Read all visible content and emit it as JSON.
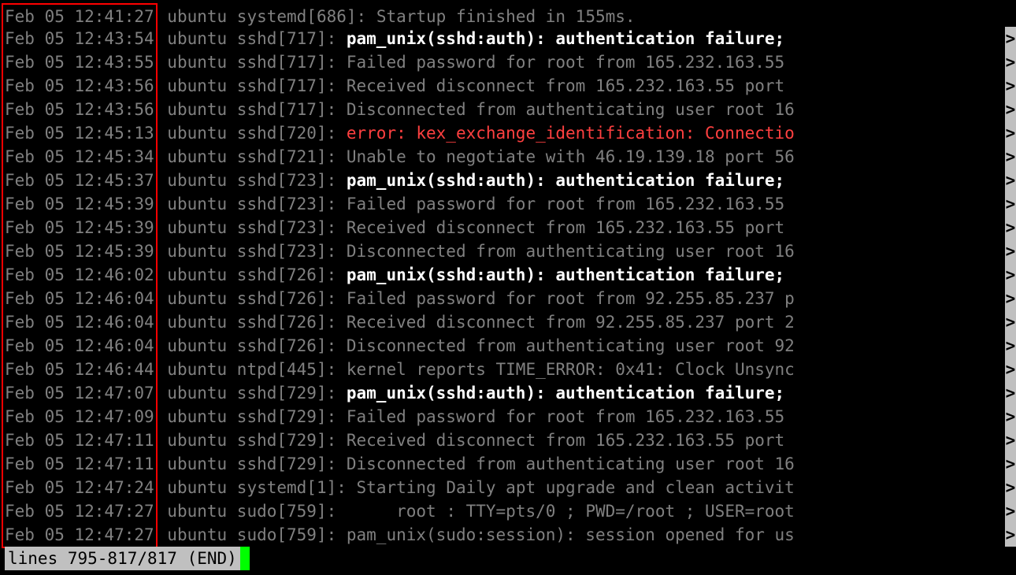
{
  "status_line": "lines 795-817/817 (END)",
  "truncation_mark": ">",
  "log_lines": [
    {
      "timestamp": "Feb 05 12:41:27",
      "prefix": " ubuntu systemd[686]: ",
      "segments": [
        {
          "cls": "dim",
          "t": "Startup finished in 155ms."
        }
      ],
      "truncated": false,
      "box": true,
      "first": true
    },
    {
      "timestamp": "Feb 05 12:43:54",
      "prefix": " ubuntu sshd[717]: ",
      "segments": [
        {
          "cls": "white",
          "t": "pam_unix(sshd:auth): authentication failure;"
        }
      ],
      "truncated": true,
      "box": true
    },
    {
      "timestamp": "Feb 05 12:43:55",
      "prefix": " ubuntu sshd[717]: ",
      "segments": [
        {
          "cls": "dim",
          "t": "Failed password for root from 165.232.163.55"
        }
      ],
      "truncated": true,
      "box": true
    },
    {
      "timestamp": "Feb 05 12:43:56",
      "prefix": " ubuntu sshd[717]: ",
      "segments": [
        {
          "cls": "dim",
          "t": "Received disconnect from 165.232.163.55 port "
        }
      ],
      "truncated": true,
      "box": true
    },
    {
      "timestamp": "Feb 05 12:43:56",
      "prefix": " ubuntu sshd[717]: ",
      "segments": [
        {
          "cls": "dim",
          "t": "Disconnected from authenticating user root 16"
        }
      ],
      "truncated": true,
      "box": true
    },
    {
      "timestamp": "Feb 05 12:45:13",
      "prefix": " ubuntu sshd[720]: ",
      "segments": [
        {
          "cls": "red",
          "t": "error: kex_exchange_identification: Connectio"
        }
      ],
      "truncated": true,
      "box": true
    },
    {
      "timestamp": "Feb 05 12:45:34",
      "prefix": " ubuntu sshd[721]: ",
      "segments": [
        {
          "cls": "dim",
          "t": "Unable to negotiate with 46.19.139.18 port 56"
        }
      ],
      "truncated": true,
      "box": true
    },
    {
      "timestamp": "Feb 05 12:45:37",
      "prefix": " ubuntu sshd[723]: ",
      "segments": [
        {
          "cls": "white",
          "t": "pam_unix(sshd:auth): authentication failure;"
        }
      ],
      "truncated": true,
      "box": true
    },
    {
      "timestamp": "Feb 05 12:45:39",
      "prefix": " ubuntu sshd[723]: ",
      "segments": [
        {
          "cls": "dim",
          "t": "Failed password for root from 165.232.163.55"
        }
      ],
      "truncated": true,
      "box": true
    },
    {
      "timestamp": "Feb 05 12:45:39",
      "prefix": " ubuntu sshd[723]: ",
      "segments": [
        {
          "cls": "dim",
          "t": "Received disconnect from 165.232.163.55 port "
        }
      ],
      "truncated": true,
      "box": true
    },
    {
      "timestamp": "Feb 05 12:45:39",
      "prefix": " ubuntu sshd[723]: ",
      "segments": [
        {
          "cls": "dim",
          "t": "Disconnected from authenticating user root 16"
        }
      ],
      "truncated": true,
      "box": true
    },
    {
      "timestamp": "Feb 05 12:46:02",
      "prefix": " ubuntu sshd[726]: ",
      "segments": [
        {
          "cls": "white",
          "t": "pam_unix(sshd:auth): authentication failure;"
        }
      ],
      "truncated": true,
      "box": true
    },
    {
      "timestamp": "Feb 05 12:46:04",
      "prefix": " ubuntu sshd[726]: ",
      "segments": [
        {
          "cls": "dim",
          "t": "Failed password for root from 92.255.85.237 p"
        }
      ],
      "truncated": true,
      "box": true
    },
    {
      "timestamp": "Feb 05 12:46:04",
      "prefix": " ubuntu sshd[726]: ",
      "segments": [
        {
          "cls": "dim",
          "t": "Received disconnect from 92.255.85.237 port 2"
        }
      ],
      "truncated": true,
      "box": true
    },
    {
      "timestamp": "Feb 05 12:46:04",
      "prefix": " ubuntu sshd[726]: ",
      "segments": [
        {
          "cls": "dim",
          "t": "Disconnected from authenticating user root 92"
        }
      ],
      "truncated": true,
      "box": true
    },
    {
      "timestamp": "Feb 05 12:46:44",
      "prefix": " ubuntu ntpd[445]: ",
      "segments": [
        {
          "cls": "dim",
          "t": "kernel reports TIME_ERROR: 0x41: Clock Unsync"
        }
      ],
      "truncated": true,
      "box": true
    },
    {
      "timestamp": "Feb 05 12:47:07",
      "prefix": " ubuntu sshd[729]: ",
      "segments": [
        {
          "cls": "white",
          "t": "pam_unix(sshd:auth): authentication failure;"
        }
      ],
      "truncated": true,
      "box": true
    },
    {
      "timestamp": "Feb 05 12:47:09",
      "prefix": " ubuntu sshd[729]: ",
      "segments": [
        {
          "cls": "dim",
          "t": "Failed password for root from 165.232.163.55"
        }
      ],
      "truncated": true,
      "box": true
    },
    {
      "timestamp": "Feb 05 12:47:11",
      "prefix": " ubuntu sshd[729]: ",
      "segments": [
        {
          "cls": "dim",
          "t": "Received disconnect from 165.232.163.55 port "
        }
      ],
      "truncated": true,
      "box": true
    },
    {
      "timestamp": "Feb 05 12:47:11",
      "prefix": " ubuntu sshd[729]: ",
      "segments": [
        {
          "cls": "dim",
          "t": "Disconnected from authenticating user root 16"
        }
      ],
      "truncated": true,
      "box": true
    },
    {
      "timestamp": "Feb 05 12:47:24",
      "prefix": " ubuntu systemd[1]: ",
      "segments": [
        {
          "cls": "dim",
          "t": "Starting Daily apt upgrade and clean activit"
        }
      ],
      "truncated": true,
      "box": true
    },
    {
      "timestamp": "Feb 05 12:47:27",
      "prefix": " ubuntu sudo[759]:    ",
      "segments": [
        {
          "cls": "dim",
          "t": "  root : TTY=pts/0 ; PWD=/root ; USER=root "
        }
      ],
      "truncated": true,
      "box": true
    },
    {
      "timestamp": "Feb 05 12:47:27",
      "prefix": " ubuntu sudo[759]: ",
      "segments": [
        {
          "cls": "dim",
          "t": "pam_unix(sudo:session): session opened for us"
        }
      ],
      "truncated": true,
      "box": true,
      "last": true
    }
  ]
}
